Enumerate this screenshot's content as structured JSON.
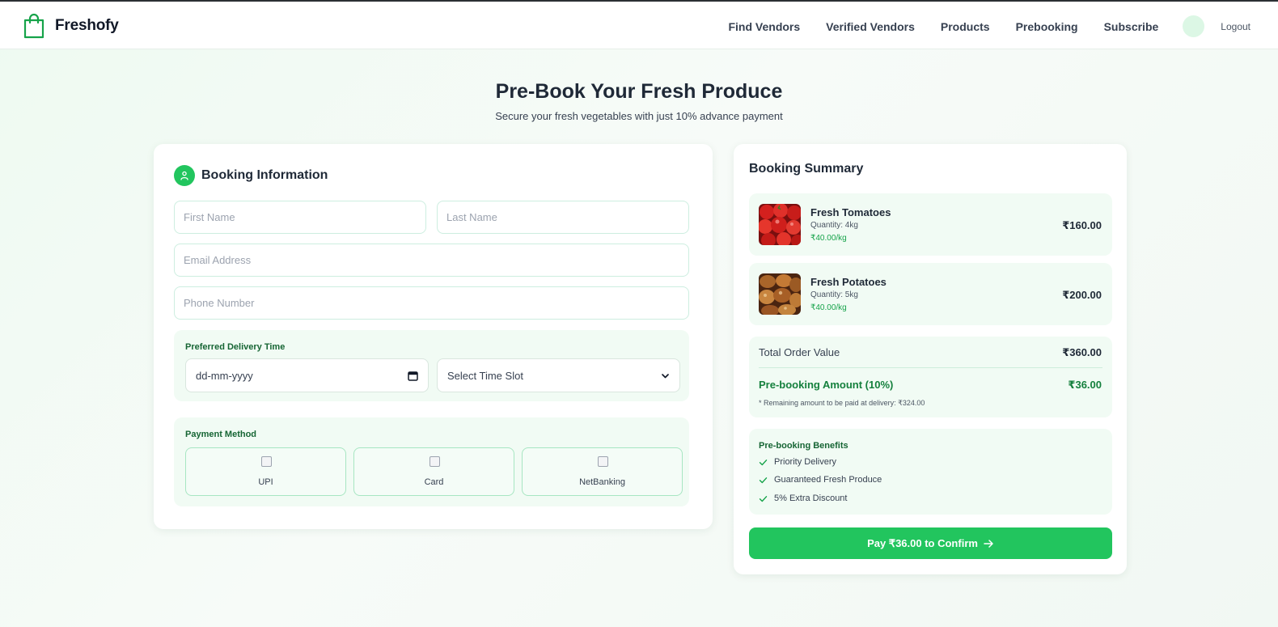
{
  "brand": {
    "name": "Freshofy",
    "icon": "shopping-bag-icon",
    "color": "#16a34a"
  },
  "nav": {
    "links": [
      "Find Vendors",
      "Verified Vendors",
      "Products",
      "Prebooking",
      "Subscribe"
    ],
    "logout": "Logout"
  },
  "hero": {
    "title": "Pre-Book Your Fresh Produce",
    "subtitle": "Secure your fresh vegetables with just 10% advance payment"
  },
  "form": {
    "title": "Booking Information",
    "icon": "user-icon",
    "first_name_placeholder": "First Name",
    "last_name_placeholder": "Last Name",
    "email_placeholder": "Email Address",
    "phone_placeholder": "Phone Number",
    "delivery": {
      "label": "Preferred Delivery Time",
      "date_placeholder": "dd-mm-yyyy",
      "time_slot": "Select Time Slot"
    },
    "payment": {
      "label": "Payment Method",
      "options": [
        "UPI",
        "Card",
        "NetBanking"
      ]
    }
  },
  "summary": {
    "title": "Booking Summary",
    "items": [
      {
        "name": "Fresh Tomatoes",
        "quantity": "Quantity: 4kg",
        "rate": "₹40.00/kg",
        "price": "₹160.00"
      },
      {
        "name": "Fresh Potatoes",
        "quantity": "Quantity: 5kg",
        "rate": "₹40.00/kg",
        "price": "₹200.00"
      }
    ],
    "total_label": "Total Order Value",
    "total_value": "₹360.00",
    "prebooking_label": "Pre-booking Amount (10%)",
    "prebooking_value": "₹36.00",
    "remaining_note": "* Remaining amount to be paid at delivery: ₹324.00",
    "benefits_title": "Pre-booking Benefits",
    "benefits": [
      "Priority Delivery",
      "Guaranteed Fresh Produce",
      "5% Extra Discount"
    ],
    "pay_button": "Pay ₹36.00 to Confirm"
  },
  "colors": {
    "accent": "#22c55e",
    "accent_dark": "#15803d",
    "panel": "#f1fbf4"
  }
}
